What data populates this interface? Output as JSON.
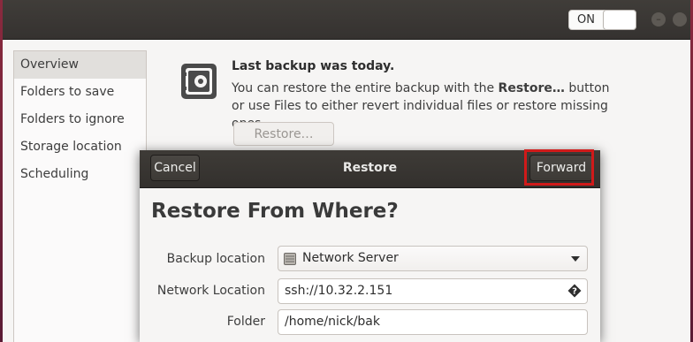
{
  "headerbar": {
    "switch_label": "ON"
  },
  "sidebar": {
    "items": [
      {
        "label": "Overview",
        "selected": true
      },
      {
        "label": "Folders to save"
      },
      {
        "label": "Folders to ignore"
      },
      {
        "label": "Storage location"
      },
      {
        "label": "Scheduling"
      }
    ]
  },
  "overview": {
    "title": "Last backup was today.",
    "desc_before": "You can restore the entire backup with the ",
    "desc_bold": "Restore…",
    "desc_after": " button or use Files to either revert individual files or restore missing ones.",
    "restore_button": "Restore…"
  },
  "dialog": {
    "title": "Restore",
    "cancel_label": "Cancel",
    "forward_label": "Forward",
    "heading": "Restore From Where?",
    "backup_location_label": "Backup location",
    "backup_location_value": "Network Server",
    "network_location_label": "Network Location",
    "network_location_value": "ssh://10.32.2.151",
    "folder_label": "Folder",
    "folder_value": "/home/nick/bak"
  },
  "colors": {
    "highlight": "#d01a1a",
    "headerbar": "#3a3733"
  }
}
